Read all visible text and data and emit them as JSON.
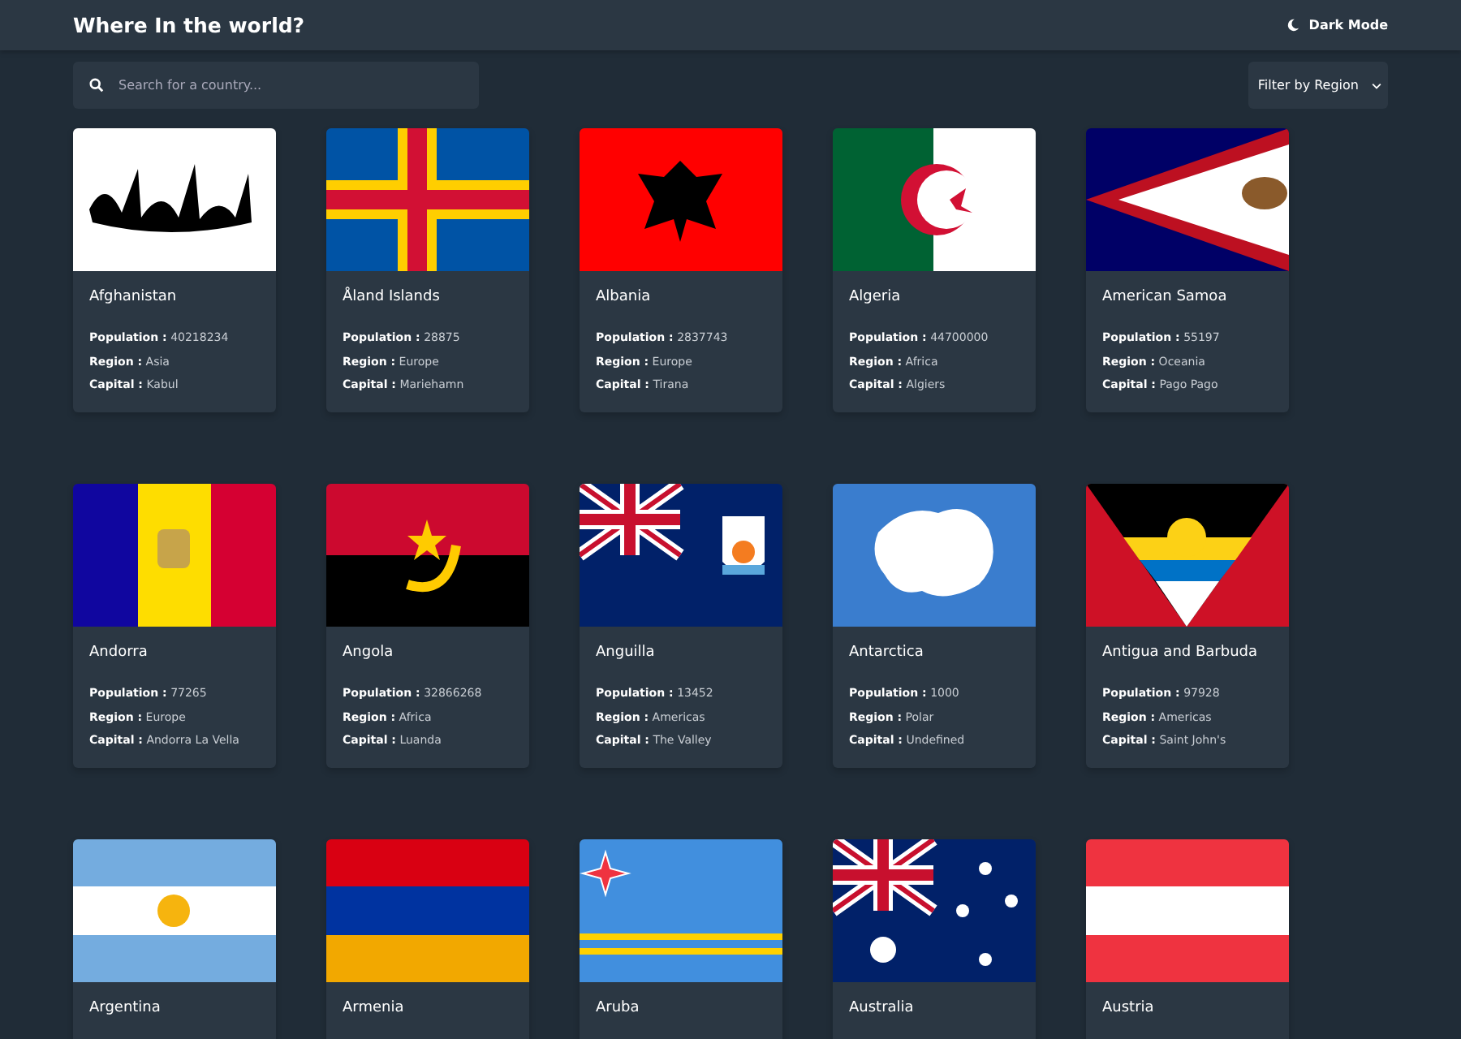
{
  "header": {
    "title": "Where In the world?",
    "theme_toggle": "Dark Mode"
  },
  "search": {
    "placeholder": "Search for a country..."
  },
  "filter": {
    "label": "Filter by Region"
  },
  "countries": [
    {
      "name": "Afghanistan",
      "population_label": "Population :",
      "population": "40218234",
      "region_label": "Region :",
      "region": "Asia",
      "capital_label": "Capital :",
      "capital": "Kabul"
    },
    {
      "name": "Åland Islands",
      "population_label": "Population :",
      "population": "28875",
      "region_label": "Region :",
      "region": "Europe",
      "capital_label": "Capital :",
      "capital": "Mariehamn"
    },
    {
      "name": "Albania",
      "population_label": "Population :",
      "population": "2837743",
      "region_label": "Region :",
      "region": "Europe",
      "capital_label": "Capital :",
      "capital": "Tirana"
    },
    {
      "name": "Algeria",
      "population_label": "Population :",
      "population": "44700000",
      "region_label": "Region :",
      "region": "Africa",
      "capital_label": "Capital :",
      "capital": "Algiers"
    },
    {
      "name": "American Samoa",
      "population_label": "Population :",
      "population": "55197",
      "region_label": "Region :",
      "region": "Oceania",
      "capital_label": "Capital :",
      "capital": "Pago Pago"
    },
    {
      "name": "Andorra",
      "population_label": "Population :",
      "population": "77265",
      "region_label": "Region :",
      "region": "Europe",
      "capital_label": "Capital :",
      "capital": "Andorra La Vella"
    },
    {
      "name": "Angola",
      "population_label": "Population :",
      "population": "32866268",
      "region_label": "Region :",
      "region": "Africa",
      "capital_label": "Capital :",
      "capital": "Luanda"
    },
    {
      "name": "Anguilla",
      "population_label": "Population :",
      "population": "13452",
      "region_label": "Region :",
      "region": "Americas",
      "capital_label": "Capital :",
      "capital": "The Valley"
    },
    {
      "name": "Antarctica",
      "population_label": "Population :",
      "population": "1000",
      "region_label": "Region :",
      "region": "Polar",
      "capital_label": "Capital :",
      "capital": "Undefined"
    },
    {
      "name": "Antigua and Barbuda",
      "population_label": "Population :",
      "population": "97928",
      "region_label": "Region :",
      "region": "Americas",
      "capital_label": "Capital :",
      "capital": "Saint John's"
    },
    {
      "name": "Argentina"
    },
    {
      "name": "Armenia"
    },
    {
      "name": "Aruba"
    },
    {
      "name": "Australia"
    },
    {
      "name": "Austria"
    }
  ]
}
